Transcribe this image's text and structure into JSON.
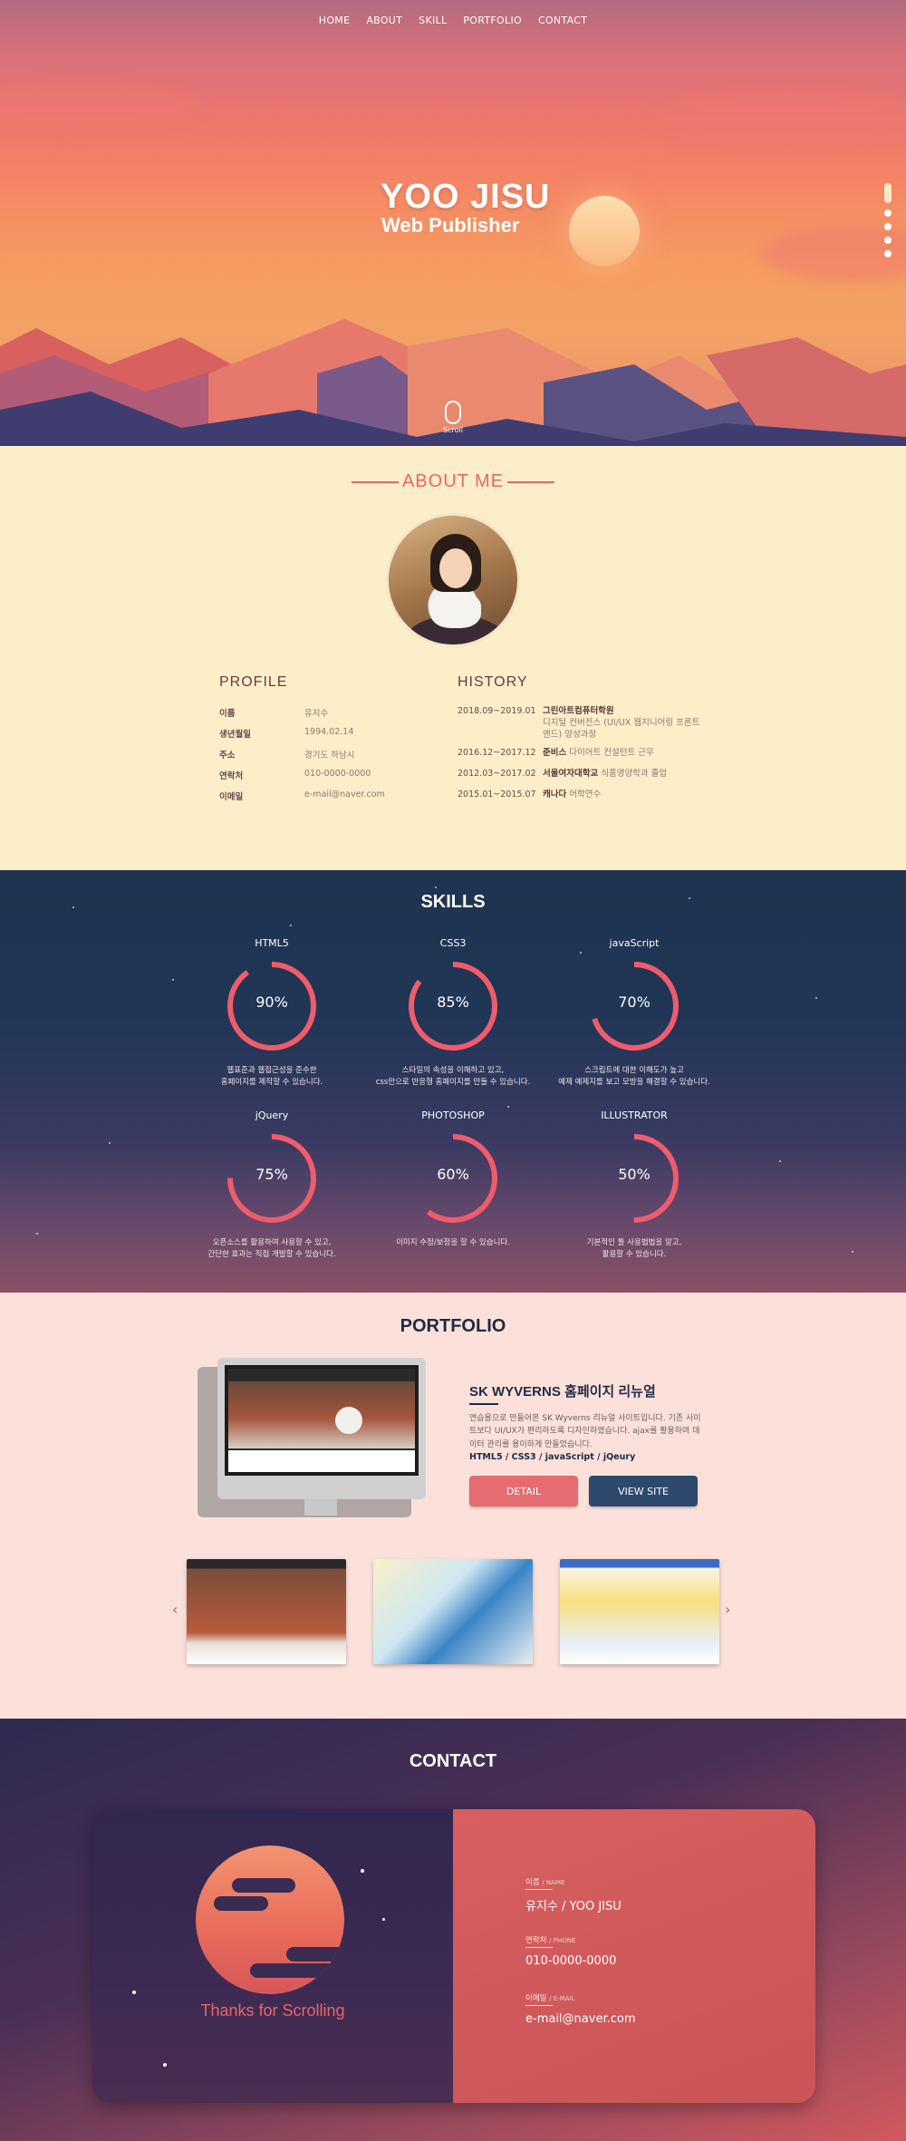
{
  "nav": [
    "HOME",
    "ABOUT",
    "SKILL",
    "PORTFOLIO",
    "CONTACT"
  ],
  "hero": {
    "title": "YOO JISU",
    "subtitle": "Web Publisher",
    "scroll_label": "Scroll"
  },
  "about": {
    "heading": "ABOUT ME",
    "profile_title": "PROFILE",
    "history_title": "HISTORY",
    "profile": [
      {
        "key": "이름",
        "value": "유지수"
      },
      {
        "key": "생년월일",
        "value": "1994.02.14"
      },
      {
        "key": "주소",
        "value": "경기도 하남시"
      },
      {
        "key": "연락처",
        "value": "010-0000-0000"
      },
      {
        "key": "이메일",
        "value": "e-mail@naver.com"
      }
    ],
    "history": [
      {
        "date": "2018.09~2019.01",
        "org": "그린아트컴퓨터학원",
        "text": "디지털 컨버전스 (UI/UX 웹지니어링 프론트엔드) 양성과정"
      },
      {
        "date": "2016.12~2017.12",
        "org": "준비스",
        "text": "다이어트 컨설턴트 근무"
      },
      {
        "date": "2012.03~2017.02",
        "org": "서울여자대학교",
        "text": "식품영양학과 졸업"
      },
      {
        "date": "2015.01~2015.07",
        "org": "캐나다",
        "text": "어학연수"
      }
    ]
  },
  "skills": {
    "heading": "SKILLS",
    "items": [
      {
        "name": "HTML5",
        "percent": 90,
        "pct_label": "90%",
        "desc1": "웹표준과 웹접근성을 준수한",
        "desc2": "홈페이지를 제작할 수 있습니다."
      },
      {
        "name": "CSS3",
        "percent": 85,
        "pct_label": "85%",
        "desc1": "스타일의 속성을 이해하고 있고,",
        "desc2": "css만으로 반응형 홈페이지를 만들 수 있습니다."
      },
      {
        "name": "javaScript",
        "percent": 70,
        "pct_label": "70%",
        "desc1": "스크립트에 대한 이해도가 높고",
        "desc2": "예제 예제지를 보고 모방을 해결할 수 있습니다."
      },
      {
        "name": "jQuery",
        "percent": 75,
        "pct_label": "75%",
        "desc1": "오픈소스를 활용하여 사용할 수 있고,",
        "desc2": "간단한 효과는 직접 개발할 수 있습니다."
      },
      {
        "name": "PHOTOSHOP",
        "percent": 60,
        "pct_label": "60%",
        "desc1": "이미지 수정/보정을 할 수 있습니다.",
        "desc2": ""
      },
      {
        "name": "ILLUSTRATOR",
        "percent": 50,
        "pct_label": "50%",
        "desc1": "기본적인 툴 사용법법을 알고,",
        "desc2": "활용할 수 있습니다."
      }
    ],
    "ring_color": "#f05c6c"
  },
  "portfolio": {
    "heading": "PORTFOLIO",
    "project_title": "SK WYVERNS 홈페이지 리뉴얼",
    "desc": "연습용으로 만들어본 SK Wyverns 리뉴얼 사이트입니다. 기존 사이트보다 UI/UX가 편리하도록 디자인하였습니다. ajax를 활용하여 데이터 관리를 용이하게 만들었습니다.",
    "tech": "HTML5 / CSS3 / javaScript / jQeury",
    "detail_label": "DETAIL",
    "view_label": "VIEW SITE",
    "prev_arrow": "‹",
    "next_arrow": "›"
  },
  "contact": {
    "heading": "CONTACT",
    "thanks": "Thanks for Scrolling",
    "name_label": "이름",
    "name_sub": "/ NAME",
    "name_value": "유지수 / YOO JISU",
    "phone_label": "연락처",
    "phone_sub": "/ PHONE",
    "phone_value": "010-0000-0000",
    "email_label": "이메일",
    "email_sub": "/ E-MAIL",
    "email_value": "e-mail@naver.com"
  }
}
